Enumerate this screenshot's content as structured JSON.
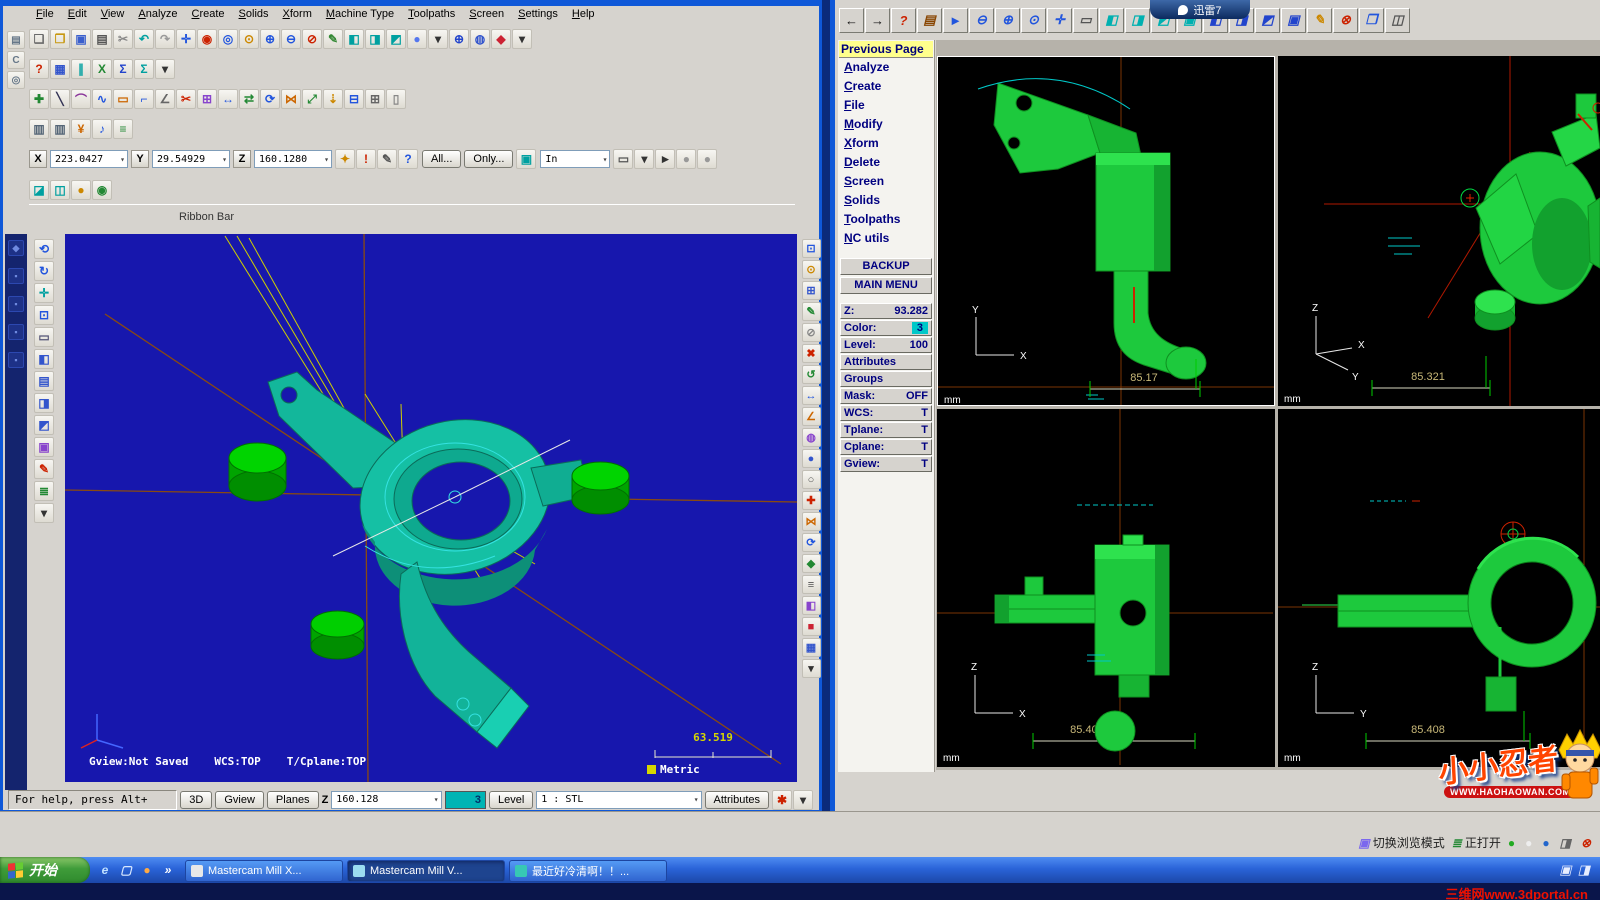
{
  "desktop": {
    "xunlei_label": "迅雷7",
    "bottom_watermark": "三维网www.3dportal.cn"
  },
  "left_window": {
    "menus": [
      "File",
      "Edit",
      "View",
      "Analyze",
      "Create",
      "Solids",
      "Xform",
      "Machine Type",
      "Toolpaths",
      "Screen",
      "Settings",
      "Help"
    ],
    "ribbon_bar_label": "Ribbon Bar",
    "toolbar_main": [
      {
        "n": "new-file-icon",
        "g": "❏",
        "c": "#6a6a6a"
      },
      {
        "n": "open-file-icon",
        "g": "❐",
        "c": "#c79810"
      },
      {
        "n": "save-icon",
        "g": "▣",
        "c": "#3a5fcd"
      },
      {
        "n": "print-icon",
        "g": "▤",
        "c": "#555555"
      },
      {
        "n": "cut-icon",
        "g": "✂",
        "c": "#888888"
      },
      {
        "n": "undo-icon",
        "g": "↶",
        "c": "#00a0a0"
      },
      {
        "n": "redo-icon",
        "g": "↷",
        "c": "#999999"
      },
      {
        "n": "pan-icon",
        "g": "✛",
        "c": "#2255dd"
      },
      {
        "n": "dynamic-rotate-icon",
        "g": "◉",
        "c": "#cc2200"
      },
      {
        "n": "zoom-window-icon",
        "g": "◎",
        "c": "#2255dd"
      },
      {
        "n": "zoom-target-icon",
        "g": "⊙",
        "c": "#cc8800"
      },
      {
        "n": "zoom-in-icon",
        "g": "⊕",
        "c": "#2255dd"
      },
      {
        "n": "zoom-out-icon",
        "g": "⊖",
        "c": "#2255dd"
      },
      {
        "n": "unzoom-icon",
        "g": "⊘",
        "c": "#cc2200"
      },
      {
        "n": "repaint-icon",
        "g": "✎",
        "c": "#338833"
      },
      {
        "n": "gview-cube-icon",
        "g": "◧",
        "c": "#00a0a0"
      },
      {
        "n": "cplane-cube-icon",
        "g": "◨",
        "c": "#00a0a0"
      },
      {
        "n": "wcs-cube-icon",
        "g": "◩",
        "c": "#00a0a0"
      },
      {
        "n": "shading-icon",
        "g": "●",
        "c": "#5577ee"
      },
      {
        "n": "shading-caret-icon",
        "g": "▾",
        "c": "#333333"
      },
      {
        "n": "world-icon",
        "g": "⊕",
        "c": "#2244cc"
      },
      {
        "n": "sphere-icon",
        "g": "◍",
        "c": "#3355cc"
      },
      {
        "n": "toggle-icon",
        "g": "◆",
        "c": "#cc2233"
      },
      {
        "n": "toggle-caret-icon",
        "g": "▾",
        "c": "#333333"
      }
    ],
    "toolbar_second": [
      {
        "n": "help-icon",
        "g": "?",
        "c": "#cc2200"
      },
      {
        "n": "grid-icon",
        "g": "▦",
        "c": "#3355cc"
      },
      {
        "n": "pause-icon",
        "g": "∥",
        "c": "#00a0a0"
      },
      {
        "n": "x-analyze-icon",
        "g": "X",
        "c": "#228833"
      },
      {
        "n": "sigma-icon",
        "g": "Σ",
        "c": "#2244cc"
      },
      {
        "n": "sigma-alt-icon",
        "g": "Σ",
        "c": "#00a0a0"
      },
      {
        "n": "second-caret-icon",
        "g": "▾",
        "c": "#333333"
      }
    ],
    "toolbar_create": [
      {
        "n": "create-point-icon",
        "g": "✚",
        "c": "#228833"
      },
      {
        "n": "create-line-icon",
        "g": "╲",
        "c": "#333355"
      },
      {
        "n": "create-arc-icon",
        "g": "⌒",
        "c": "#883399"
      },
      {
        "n": "create-spline-icon",
        "g": "∿",
        "c": "#2255dd"
      },
      {
        "n": "create-rect-icon",
        "g": "▭",
        "c": "#cc6600"
      },
      {
        "n": "create-fillet-icon",
        "g": "⌐",
        "c": "#2255dd"
      },
      {
        "n": "create-chamfer-icon",
        "g": "∠",
        "c": "#666666"
      },
      {
        "n": "trim-icon",
        "g": "✂",
        "c": "#cc2200"
      },
      {
        "n": "drafting-icon",
        "g": "⊞",
        "c": "#8844cc"
      },
      {
        "n": "dimension-icon",
        "g": "↔",
        "c": "#2255dd"
      },
      {
        "n": "xform-translate-icon",
        "g": "⇄",
        "c": "#228833"
      },
      {
        "n": "xform-rotate-icon",
        "g": "⟳",
        "c": "#2255dd"
      },
      {
        "n": "xform-mirror-icon",
        "g": "⋈",
        "c": "#cc6600"
      },
      {
        "n": "xform-scale-icon",
        "g": "⤢",
        "c": "#228833"
      },
      {
        "n": "sort-icon",
        "g": "⇣",
        "c": "#cc8800"
      },
      {
        "n": "levels-icon",
        "g": "⊟",
        "c": "#2255dd"
      },
      {
        "n": "grid-settings-icon",
        "g": "⊞",
        "c": "#666666"
      },
      {
        "n": "note-icon",
        "g": "▯",
        "c": "#888888"
      }
    ],
    "toolbar_small": [
      {
        "n": "machine-group-icon",
        "g": "▥",
        "c": "#556677"
      },
      {
        "n": "control-def-icon",
        "g": "▥",
        "c": "#556677"
      },
      {
        "n": "currency-icon",
        "g": "¥",
        "c": "#cc6600"
      },
      {
        "n": "music-icon",
        "g": "♪",
        "c": "#2255dd"
      },
      {
        "n": "list-icon",
        "g": "≡",
        "c": "#228833"
      }
    ],
    "coord": {
      "x_label": "X",
      "x_value": "223.0427",
      "y_label": "Y",
      "y_value": "29.54929",
      "z_label": "Z",
      "z_value": "160.1280",
      "all_button": "All...",
      "only_button": "Only...",
      "in_value": "In"
    },
    "coord_icons_a": [
      {
        "n": "fastpoint-icon",
        "g": "✦",
        "c": "#cc8800"
      },
      {
        "n": "guess-icon",
        "g": "!",
        "c": "#cc2200"
      },
      {
        "n": "sketch-icon",
        "g": "✎",
        "c": "#555555"
      },
      {
        "n": "help-cursor-icon",
        "g": "?",
        "c": "#2255dd"
      }
    ],
    "coord_icons_b": [
      {
        "n": "select-cube-icon",
        "g": "▣",
        "c": "#00a0a0"
      }
    ],
    "coord_icons_c": [
      {
        "n": "window-select-icon",
        "g": "▭",
        "c": "#555555"
      },
      {
        "n": "window-select-caret-icon",
        "g": "▾",
        "c": "#333333"
      },
      {
        "n": "select-cursor-icon",
        "g": "►",
        "c": "#333333"
      },
      {
        "n": "select-all-circle-icon",
        "g": "●",
        "c": "#999999"
      },
      {
        "n": "select-none-circle-icon",
        "g": "●",
        "c": "#999999"
      }
    ],
    "view_row_icons": [
      {
        "n": "wcs-view-icon",
        "g": "◪",
        "c": "#00a0a0"
      },
      {
        "n": "plane-view-icon",
        "g": "◫",
        "c": "#00a0a0"
      },
      {
        "n": "world-sphere-icon",
        "g": "●",
        "c": "#cc8800"
      },
      {
        "n": "ok-icon",
        "g": "◉",
        "c": "#228833"
      }
    ],
    "dock_top": [
      {
        "n": "dock-print-icon",
        "g": "▤",
        "c": "#667788"
      },
      {
        "n": "dock-c-icon",
        "g": "C",
        "c": "#667788"
      },
      {
        "n": "dock-disc-icon",
        "g": "◎",
        "c": "#667788"
      }
    ],
    "dock_side": [
      {
        "n": "dock-side-icon",
        "g": "◆",
        "c": "#6f8ae0"
      },
      {
        "n": "dock-side-icon",
        "g": "▪",
        "c": "#6f8ae0"
      },
      {
        "n": "dock-side-icon",
        "g": "▪",
        "c": "#6f8ae0"
      },
      {
        "n": "dock-side-icon",
        "g": "▪",
        "c": "#6f8ae0"
      },
      {
        "n": "dock-side-icon",
        "g": "▪",
        "c": "#6f8ae0"
      }
    ],
    "left_toolbar": [
      {
        "n": "gview-dynamic-icon",
        "g": "⟲",
        "c": "#2255dd"
      },
      {
        "n": "gview-rotate-icon",
        "g": "↻",
        "c": "#2255dd"
      },
      {
        "n": "pan-view-icon",
        "g": "✛",
        "c": "#00a0a0"
      },
      {
        "n": "fit-view-icon",
        "g": "⊡",
        "c": "#2255dd"
      },
      {
        "n": "blank-view-icon",
        "g": "▭",
        "c": "#555577"
      },
      {
        "n": "front-view-icon",
        "g": "◧",
        "c": "#3355cc"
      },
      {
        "n": "top-view-icon",
        "g": "▤",
        "c": "#3355cc"
      },
      {
        "n": "side-view-icon",
        "g": "◨",
        "c": "#3355cc"
      },
      {
        "n": "iso-view-icon",
        "g": "◩",
        "c": "#3355cc"
      },
      {
        "n": "saved-view-icon",
        "g": "▣",
        "c": "#8844cc"
      },
      {
        "n": "redraw-icon",
        "g": "✎",
        "c": "#cc2200"
      },
      {
        "n": "levels-list-icon",
        "g": "≣",
        "c": "#228833"
      },
      {
        "n": "views-caret-icon",
        "g": "▾",
        "c": "#333333"
      }
    ],
    "right_toolbar": [
      {
        "n": "fit-screen-icon",
        "g": "⊡",
        "c": "#2255dd"
      },
      {
        "n": "zoom-selected-icon",
        "g": "⊙",
        "c": "#cc8800"
      },
      {
        "n": "grid-snap-icon",
        "g": "⊞",
        "c": "#3355cc"
      },
      {
        "n": "repaint-screen-icon",
        "g": "✎",
        "c": "#228833"
      },
      {
        "n": "blank-entity-icon",
        "g": "⊘",
        "c": "#888888"
      },
      {
        "n": "delete-entity-icon",
        "g": "✖",
        "c": "#cc2200"
      },
      {
        "n": "undelete-icon",
        "g": "↺",
        "c": "#228833"
      },
      {
        "n": "analyze-distance-icon",
        "g": "↔",
        "c": "#2255dd"
      },
      {
        "n": "analyze-angle-icon",
        "g": "∠",
        "c": "#cc6600"
      },
      {
        "n": "analyze-area-icon",
        "g": "◍",
        "c": "#8844cc"
      },
      {
        "n": "shade-on-icon",
        "g": "●",
        "c": "#3355cc"
      },
      {
        "n": "wireframe-icon",
        "g": "○",
        "c": "#555555"
      },
      {
        "n": "explode-icon",
        "g": "✚",
        "c": "#cc2200"
      },
      {
        "n": "mirror-entity-icon",
        "g": "⋈",
        "c": "#cc6600"
      },
      {
        "n": "rotate-entity-icon",
        "g": "⟳",
        "c": "#2255dd"
      },
      {
        "n": "scale-entity-icon",
        "g": "◆",
        "c": "#228833"
      },
      {
        "n": "offset-icon",
        "g": "≡",
        "c": "#555555"
      },
      {
        "n": "attributes-icon",
        "g": "◧",
        "c": "#8844cc"
      },
      {
        "n": "color-swatch-icon",
        "g": "■",
        "c": "#cc2233"
      },
      {
        "n": "level-swatch-icon",
        "g": "▦",
        "c": "#3355cc"
      },
      {
        "n": "more-tools-caret-icon",
        "g": "▾",
        "c": "#333333"
      }
    ],
    "viewport": {
      "gview_status": "Gview:Not Saved",
      "wcs_status": "WCS:TOP",
      "plane_status": "T/Cplane:TOP",
      "scale_value": "63.519",
      "units": "Metric"
    },
    "status_bar": {
      "help_text": "For help, press Alt+",
      "mode_3d": "3D",
      "gview_button": "Gview",
      "planes_button": "Planes",
      "z_label": "Z",
      "z_value": "160.128",
      "color_value": "3",
      "level_label": "Level",
      "level_value": "1 : STL",
      "attributes_button": "Attributes"
    },
    "status_icons": [
      {
        "n": "mru-icon",
        "g": "✱",
        "c": "#cc2200"
      },
      {
        "n": "mru-caret-icon",
        "g": "▾",
        "c": "#333333"
      }
    ]
  },
  "right_window": {
    "toolbar": [
      {
        "n": "back-arrow-icon",
        "g": "←",
        "c": "#111111"
      },
      {
        "n": "forward-arrow-icon",
        "g": "→",
        "c": "#111111"
      },
      {
        "n": "help-icon",
        "g": "?",
        "c": "#cc2200"
      },
      {
        "n": "clipboard-icon",
        "g": "▤",
        "c": "#884400"
      },
      {
        "n": "whats-this-icon",
        "g": "►",
        "c": "#2255dd"
      },
      {
        "n": "zoom-out-icon",
        "g": "⊖",
        "c": "#2255dd"
      },
      {
        "n": "zoom-window-icon",
        "g": "⊕",
        "c": "#2255dd"
      },
      {
        "n": "unzoom-icon",
        "g": "⊙",
        "c": "#2255dd"
      },
      {
        "n": "pan-icon",
        "g": "✛",
        "c": "#2255dd"
      },
      {
        "n": "select-box-icon",
        "g": "▭",
        "c": "#555555"
      },
      {
        "n": "gview-top-icon",
        "g": "◧",
        "c": "#00b0b0"
      },
      {
        "n": "gview-front-icon",
        "g": "◨",
        "c": "#00b0b0"
      },
      {
        "n": "gview-side-icon",
        "g": "◩",
        "c": "#00b0b0"
      },
      {
        "n": "gview-iso-icon",
        "g": "▣",
        "c": "#00b0b0"
      },
      {
        "n": "cplane-top-icon",
        "g": "◧",
        "c": "#2244cc"
      },
      {
        "n": "cplane-front-icon",
        "g": "◨",
        "c": "#2244cc"
      },
      {
        "n": "cplane-side-icon",
        "g": "◩",
        "c": "#2244cc"
      },
      {
        "n": "cplane-iso-icon",
        "g": "▣",
        "c": "#2244cc"
      },
      {
        "n": "ruler-icon",
        "g": "✎",
        "c": "#cc8800"
      },
      {
        "n": "delete-icon",
        "g": "⊗",
        "c": "#cc2200"
      },
      {
        "n": "screen-config-icon",
        "g": "❐",
        "c": "#2255dd"
      },
      {
        "n": "exit-icon",
        "g": "◫",
        "c": "#555555"
      }
    ],
    "previous_page": "Previous Page",
    "menu_items": [
      "Analyze",
      "Create",
      "File",
      "Modify",
      "Xform",
      "Delete",
      "Screen",
      "Solids",
      "Toolpaths",
      "NC utils"
    ],
    "backup_button": "BACKUP",
    "main_menu_button": "MAIN MENU",
    "status_items": [
      {
        "label": "Z:",
        "value": "93.282"
      },
      {
        "label": "Color:",
        "value": "3",
        "style": "color"
      },
      {
        "label": "Level:",
        "value": "100"
      },
      {
        "label": "Attributes",
        "value": ""
      },
      {
        "label": "Groups",
        "value": ""
      },
      {
        "label": "Mask:",
        "value": "OFF"
      },
      {
        "label": "WCS:",
        "value": "T"
      },
      {
        "label": "Tplane:",
        "value": "T"
      },
      {
        "label": "Cplane:",
        "value": "T"
      },
      {
        "label": "Gview:",
        "value": "T"
      }
    ],
    "viewports": {
      "tl": {
        "axis_v": "Y",
        "axis_h": "X",
        "scale": "85.17",
        "units": "mm"
      },
      "tr": {
        "axis_1": "Z",
        "axis_2": "Y",
        "axis_3": "X",
        "scale": "85.321",
        "units": "mm"
      },
      "bl": {
        "axis_v": "Z",
        "axis_h": "X",
        "scale": "85.400",
        "units": "mm"
      },
      "br": {
        "axis_v": "Z",
        "axis_h": "Y",
        "scale": "85.408",
        "units": "mm"
      }
    }
  },
  "tray_items": [
    {
      "n": "browser-mode-icon",
      "g": "▣",
      "c": "#7b68ee",
      "label": "切换浏览模式"
    },
    {
      "n": "ie-open-icon",
      "g": "≣",
      "c": "#228833",
      "label": "正打开"
    },
    {
      "n": "status-dot-green-icon",
      "g": "●",
      "c": "#22aa22",
      "label": ""
    },
    {
      "n": "status-dot-white-icon",
      "g": "●",
      "c": "#eeeeee",
      "label": ""
    },
    {
      "n": "status-dot-blue-icon",
      "g": "●",
      "c": "#2266cc",
      "label": ""
    },
    {
      "n": "volume-icon",
      "g": "◨",
      "c": "#666666",
      "label": ""
    },
    {
      "n": "tray-close-icon",
      "g": "⊗",
      "c": "#cc2200",
      "label": ""
    }
  ],
  "taskbar": {
    "start": "开始",
    "quick_launch": [
      {
        "n": "ie-icon",
        "g": "e",
        "c": "#bfe0ff"
      },
      {
        "n": "show-desktop-icon",
        "g": "▢",
        "c": "#d8e8ff"
      },
      {
        "n": "player-icon",
        "g": "●",
        "c": "#ffaa44"
      },
      {
        "n": "more-icon",
        "g": "»",
        "c": "#ffffff"
      }
    ],
    "tasks": [
      {
        "n": "task-mastercam-x",
        "label": "Mastercam Mill X...",
        "icon_c": "#e8e8e8"
      },
      {
        "n": "task-mastercam-v",
        "label": "Mastercam Mill V...",
        "icon_c": "#9adcf0",
        "active": "true"
      },
      {
        "n": "task-chat",
        "label": "最近好冷清啊！！...",
        "icon_c": "#37c8b4"
      }
    ],
    "tb_right": [
      {
        "n": "ime-icon",
        "g": "▣",
        "c": "#e8eeff"
      },
      {
        "n": "taskbar-desktop-icon",
        "g": "◨",
        "c": "#e8eeff"
      }
    ]
  },
  "watermark": {
    "title": "小小忍者",
    "url": "WWW.HAOHAOWAN.COM"
  }
}
